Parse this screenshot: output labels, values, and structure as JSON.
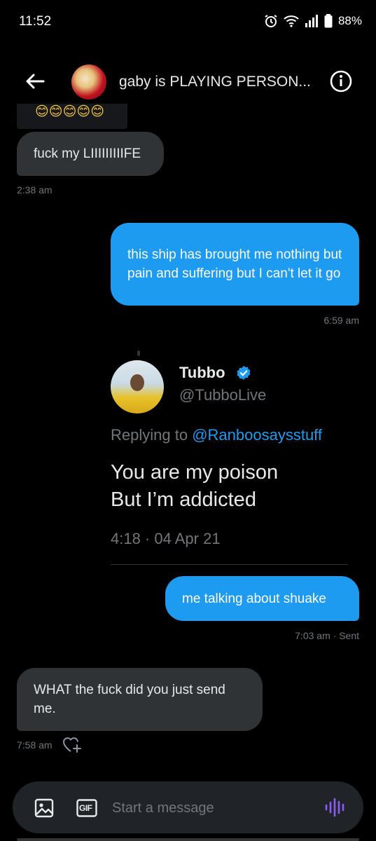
{
  "status_bar": {
    "time": "11:52",
    "battery": "88%",
    "icons": [
      "alarm-icon",
      "wifi-icon",
      "signal-icon",
      "battery-icon"
    ]
  },
  "header": {
    "title": "gaby is PLAYING PERSON...",
    "back_icon": "arrow-left-icon",
    "info_icon": "info-circle-icon"
  },
  "messages": [
    {
      "direction": "in",
      "text": "fuck my LIIIIIIIIIFE",
      "timestamp": "2:38 am"
    },
    {
      "direction": "out",
      "text": "this ship has brought me nothing but pain and suffering but I can't let it go",
      "timestamp": "6:59 am"
    },
    {
      "direction": "out",
      "text": "me talking about shuake",
      "timestamp": "7:03 am · Sent"
    },
    {
      "direction": "in",
      "text": "WHAT the fuck did you just send me.",
      "timestamp": "7:58 am"
    }
  ],
  "emoji_row": "😊😊😊😊😊",
  "quoted_tweet": {
    "name": "Tubbo",
    "handle": "@TubboLive",
    "replying_prefix": "Replying to",
    "replying_to": "@Ranboosaysstuff",
    "text_line1": "You are my poison",
    "text_line2": "But I’m addicted",
    "meta": "4:18 · 04 Apr 21"
  },
  "composer": {
    "placeholder": "Start a message",
    "gif_label": "GIF"
  },
  "colors": {
    "accent": "#1d9bf0",
    "incoming_bubble": "#2f3336",
    "background": "#000000",
    "voice_icon": "#8b5cf6"
  }
}
